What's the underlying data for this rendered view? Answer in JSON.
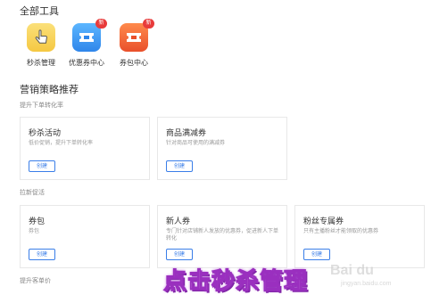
{
  "all_tools": {
    "title": "全部工具",
    "tools": [
      {
        "label": "秒杀管理",
        "icon": "hand-pointer-icon",
        "color": "#f9d65c",
        "badge": ""
      },
      {
        "label": "优惠券中心",
        "icon": "coupon-icon",
        "color": "#4aa4f5",
        "badge": "新"
      },
      {
        "label": "券包中心",
        "icon": "coupon-package-icon",
        "color": "#f36a3c",
        "badge": "新"
      }
    ]
  },
  "strategy": {
    "title": "营销策略推荐",
    "groups": [
      {
        "label": "提升下单转化率",
        "cards": [
          {
            "title": "秒杀活动",
            "desc": "低价促销，提升下单转化率",
            "button": "创建"
          },
          {
            "title": "商品满减券",
            "desc": "针对商品可使用的满减券",
            "button": "创建"
          }
        ]
      },
      {
        "label": "拉新促活",
        "cards": [
          {
            "title": "券包",
            "desc": "券包",
            "button": "创建"
          },
          {
            "title": "新人券",
            "desc": "专门针对店铺新人发放的优惠券，促进新人下单转化",
            "button": "创建"
          },
          {
            "title": "粉丝专属券",
            "desc": "只有主播粉丝才能领取的优惠券",
            "button": "创建"
          }
        ]
      },
      {
        "label": "提升客单价",
        "cards": []
      }
    ]
  },
  "overlay": {
    "caption": "点击秒杀管理"
  },
  "watermark": {
    "text": "Bai du",
    "sub": "jingyan.baidu.com"
  }
}
